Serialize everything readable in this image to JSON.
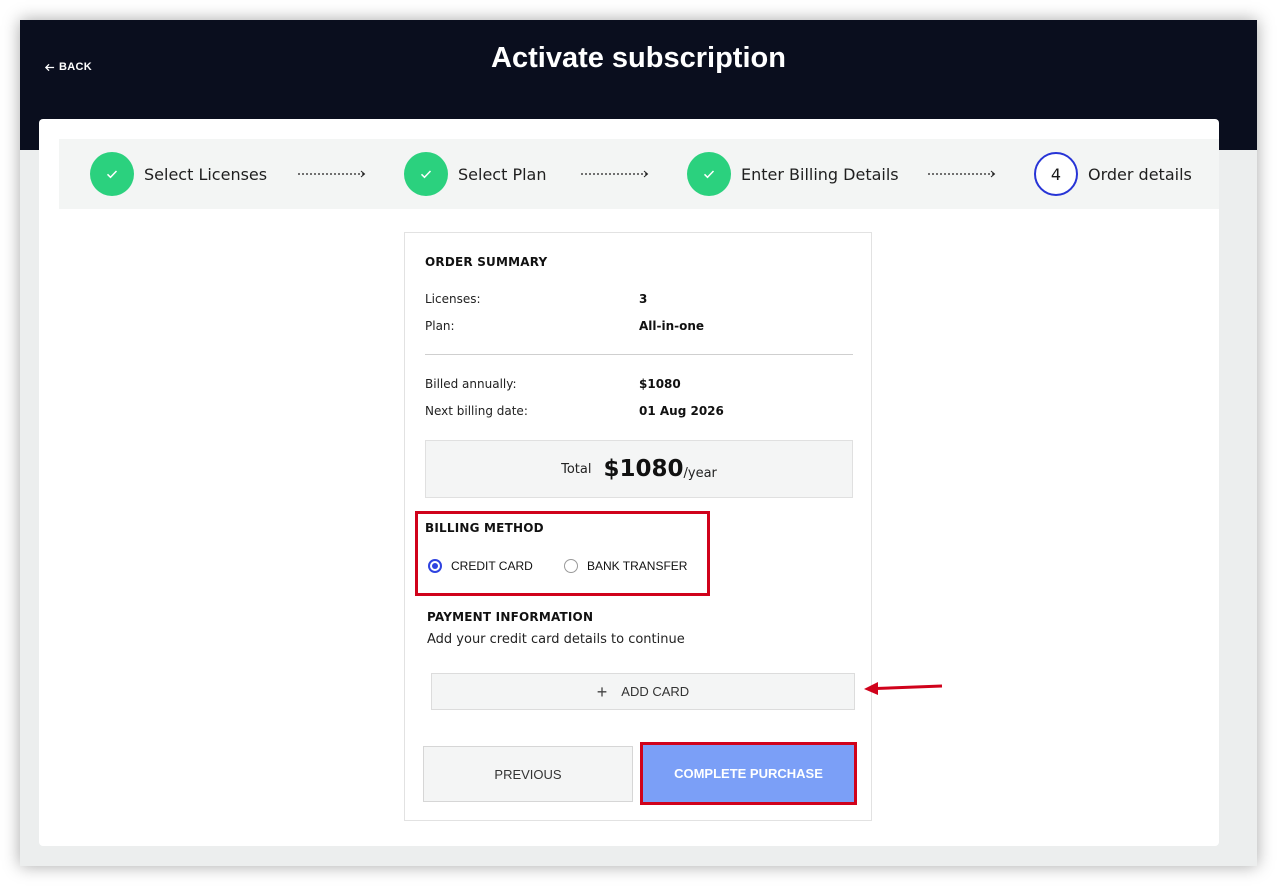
{
  "header": {
    "back_label": "BACK",
    "title": "Activate subscription"
  },
  "steps": [
    {
      "label": "Select Licenses",
      "status": "done"
    },
    {
      "label": "Select Plan",
      "status": "done"
    },
    {
      "label": "Enter Billing Details",
      "status": "done"
    },
    {
      "label": "Order details",
      "status": "active",
      "number": "4"
    }
  ],
  "order_summary": {
    "title": "ORDER SUMMARY",
    "rows": [
      {
        "label": "Licenses:",
        "value": "3"
      },
      {
        "label": "Plan:",
        "value": "All-in-one"
      },
      {
        "label": "Billed annually:",
        "value": "$1080"
      },
      {
        "label": "Next billing date:",
        "value": "01 Aug 2026"
      }
    ],
    "total": {
      "label": "Total",
      "amount": "$1080",
      "period": "/year"
    }
  },
  "billing_method": {
    "title": "BILLING METHOD",
    "options": [
      {
        "label": "CREDIT CARD",
        "selected": true
      },
      {
        "label": "BANK TRANSFER",
        "selected": false
      }
    ]
  },
  "payment": {
    "title": "PAYMENT INFORMATION",
    "subtitle": "Add your credit card details to continue",
    "add_card_label": "ADD CARD"
  },
  "actions": {
    "previous_label": "PREVIOUS",
    "complete_label": "COMPLETE PURCHASE"
  },
  "colors": {
    "header_bg": "#0a0e1e",
    "step_done": "#2bd17e",
    "step_active": "#2734d6",
    "primary_button": "#7b9ff7",
    "annotation": "#d0021b"
  }
}
